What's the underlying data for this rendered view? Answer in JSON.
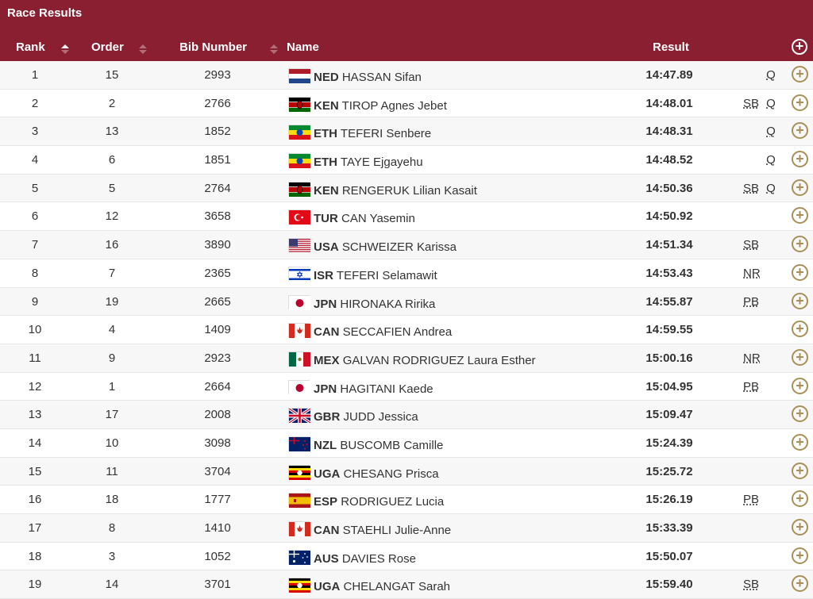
{
  "header": {
    "title": "Race Results",
    "columns": {
      "rank": "Rank",
      "order": "Order",
      "bib": "Bib Number",
      "name": "Name",
      "result": "Result"
    },
    "expand_all_icon": "plus-circle-icon"
  },
  "colors": {
    "header_bg": "#8a1f32",
    "accent": "#a88f55"
  },
  "rows": [
    {
      "rank": "1",
      "order": "15",
      "bib": "2993",
      "noc": "NED",
      "athlete": "HASSAN Sifan",
      "result": "14:47.89",
      "record": "",
      "qual": "Q",
      "flag": "ned"
    },
    {
      "rank": "2",
      "order": "2",
      "bib": "2766",
      "noc": "KEN",
      "athlete": "TIROP Agnes Jebet",
      "result": "14:48.01",
      "record": "SB",
      "qual": "Q",
      "flag": "ken"
    },
    {
      "rank": "3",
      "order": "13",
      "bib": "1852",
      "noc": "ETH",
      "athlete": "TEFERI Senbere",
      "result": "14:48.31",
      "record": "",
      "qual": "Q",
      "flag": "eth"
    },
    {
      "rank": "4",
      "order": "6",
      "bib": "1851",
      "noc": "ETH",
      "athlete": "TAYE Ejgayehu",
      "result": "14:48.52",
      "record": "",
      "qual": "Q",
      "flag": "eth"
    },
    {
      "rank": "5",
      "order": "5",
      "bib": "2764",
      "noc": "KEN",
      "athlete": "RENGERUK Lilian Kasait",
      "result": "14:50.36",
      "record": "SB",
      "qual": "Q",
      "flag": "ken"
    },
    {
      "rank": "6",
      "order": "12",
      "bib": "3658",
      "noc": "TUR",
      "athlete": "CAN Yasemin",
      "result": "14:50.92",
      "record": "",
      "qual": "",
      "flag": "tur"
    },
    {
      "rank": "7",
      "order": "16",
      "bib": "3890",
      "noc": "USA",
      "athlete": "SCHWEIZER Karissa",
      "result": "14:51.34",
      "record": "SB",
      "qual": "",
      "flag": "usa"
    },
    {
      "rank": "8",
      "order": "7",
      "bib": "2365",
      "noc": "ISR",
      "athlete": "TEFERI Selamawit",
      "result": "14:53.43",
      "record": "NR",
      "qual": "",
      "flag": "isr"
    },
    {
      "rank": "9",
      "order": "19",
      "bib": "2665",
      "noc": "JPN",
      "athlete": "HIRONAKA Ririka",
      "result": "14:55.87",
      "record": "PB",
      "qual": "",
      "flag": "jpn"
    },
    {
      "rank": "10",
      "order": "4",
      "bib": "1409",
      "noc": "CAN",
      "athlete": "SECCAFIEN Andrea",
      "result": "14:59.55",
      "record": "",
      "qual": "",
      "flag": "can"
    },
    {
      "rank": "11",
      "order": "9",
      "bib": "2923",
      "noc": "MEX",
      "athlete": "GALVAN RODRIGUEZ Laura Esther",
      "result": "15:00.16",
      "record": "NR",
      "qual": "",
      "flag": "mex"
    },
    {
      "rank": "12",
      "order": "1",
      "bib": "2664",
      "noc": "JPN",
      "athlete": "HAGITANI Kaede",
      "result": "15:04.95",
      "record": "PB",
      "qual": "",
      "flag": "jpn"
    },
    {
      "rank": "13",
      "order": "17",
      "bib": "2008",
      "noc": "GBR",
      "athlete": "JUDD Jessica",
      "result": "15:09.47",
      "record": "",
      "qual": "",
      "flag": "gbr"
    },
    {
      "rank": "14",
      "order": "10",
      "bib": "3098",
      "noc": "NZL",
      "athlete": "BUSCOMB Camille",
      "result": "15:24.39",
      "record": "",
      "qual": "",
      "flag": "nzl"
    },
    {
      "rank": "15",
      "order": "11",
      "bib": "3704",
      "noc": "UGA",
      "athlete": "CHESANG Prisca",
      "result": "15:25.72",
      "record": "",
      "qual": "",
      "flag": "uga"
    },
    {
      "rank": "16",
      "order": "18",
      "bib": "1777",
      "noc": "ESP",
      "athlete": "RODRIGUEZ Lucia",
      "result": "15:26.19",
      "record": "PB",
      "qual": "",
      "flag": "esp"
    },
    {
      "rank": "17",
      "order": "8",
      "bib": "1410",
      "noc": "CAN",
      "athlete": "STAEHLI Julie-Anne",
      "result": "15:33.39",
      "record": "",
      "qual": "",
      "flag": "can"
    },
    {
      "rank": "18",
      "order": "3",
      "bib": "1052",
      "noc": "AUS",
      "athlete": "DAVIES Rose",
      "result": "15:50.07",
      "record": "",
      "qual": "",
      "flag": "aus"
    },
    {
      "rank": "19",
      "order": "14",
      "bib": "3701",
      "noc": "UGA",
      "athlete": "CHELANGAT Sarah",
      "result": "15:59.40",
      "record": "SB",
      "qual": "",
      "flag": "uga"
    }
  ]
}
